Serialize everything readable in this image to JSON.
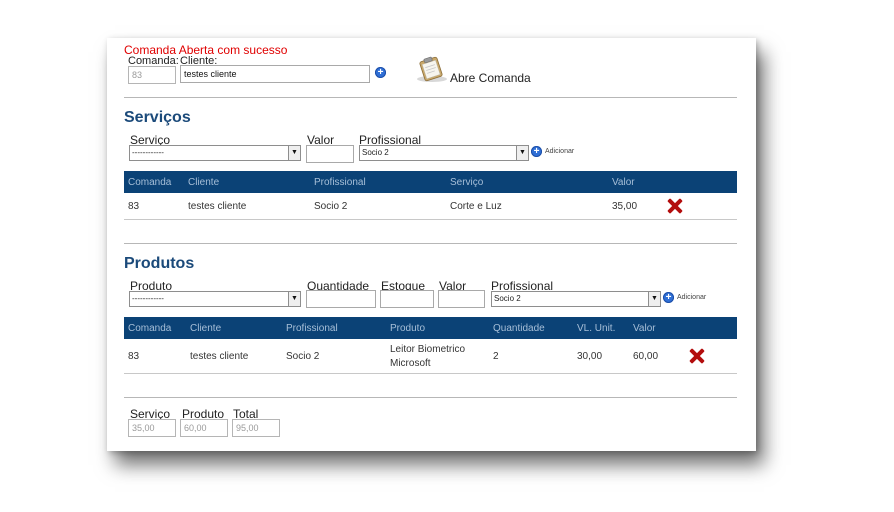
{
  "header": {
    "message": "Comanda Aberta com sucesso",
    "comanda_label": "Comanda:",
    "cliente_label": "Cliente:",
    "comanda_value": "83",
    "cliente_value": "testes cliente",
    "abre_comanda_label": "Abre Comanda"
  },
  "servicos": {
    "title": "Serviços",
    "servico_label": "Serviço",
    "valor_label": "Valor",
    "profissional_label": "Profissional",
    "servico_selected": "------------",
    "valor_value": "",
    "profissional_selected": "Socio 2",
    "add_label": "Adicionar",
    "table": {
      "headers": [
        "Comanda",
        "Cliente",
        "Profissional",
        "Serviço",
        "Valor"
      ],
      "rows": [
        {
          "comanda": "83",
          "cliente": "testes cliente",
          "profissional": "Socio 2",
          "servico": "Corte e Luz",
          "valor": "35,00"
        }
      ]
    }
  },
  "produtos": {
    "title": "Produtos",
    "produto_label": "Produto",
    "quantidade_label": "Quantidade",
    "estoque_label": "Estoque",
    "valor_label": "Valor",
    "profissional_label": "Profissional",
    "produto_selected": "------------",
    "profissional_selected": "Socio 2",
    "add_label": "Adicionar",
    "table": {
      "headers": [
        "Comanda",
        "Cliente",
        "Profissional",
        "Produto",
        "Quantidade",
        "VL. Unit.",
        "Valor"
      ],
      "rows": [
        {
          "comanda": "83",
          "cliente": "testes cliente",
          "profissional": "Socio 2",
          "produto_line1": "Leitor Biometrico",
          "produto_line2": "Microsoft",
          "quantidade": "2",
          "vl_unit": "30,00",
          "valor": "60,00"
        }
      ]
    }
  },
  "totais": {
    "servico_label": "Serviço",
    "produto_label": "Produto",
    "total_label": "Total",
    "servico_value": "35,00",
    "produto_value": "60,00",
    "total_value": "95,00"
  },
  "colors": {
    "accent_blue": "#0b4276",
    "heading_blue": "#1b4a7a",
    "success_message": "#e00000",
    "delete_red": "#b30d0d"
  }
}
